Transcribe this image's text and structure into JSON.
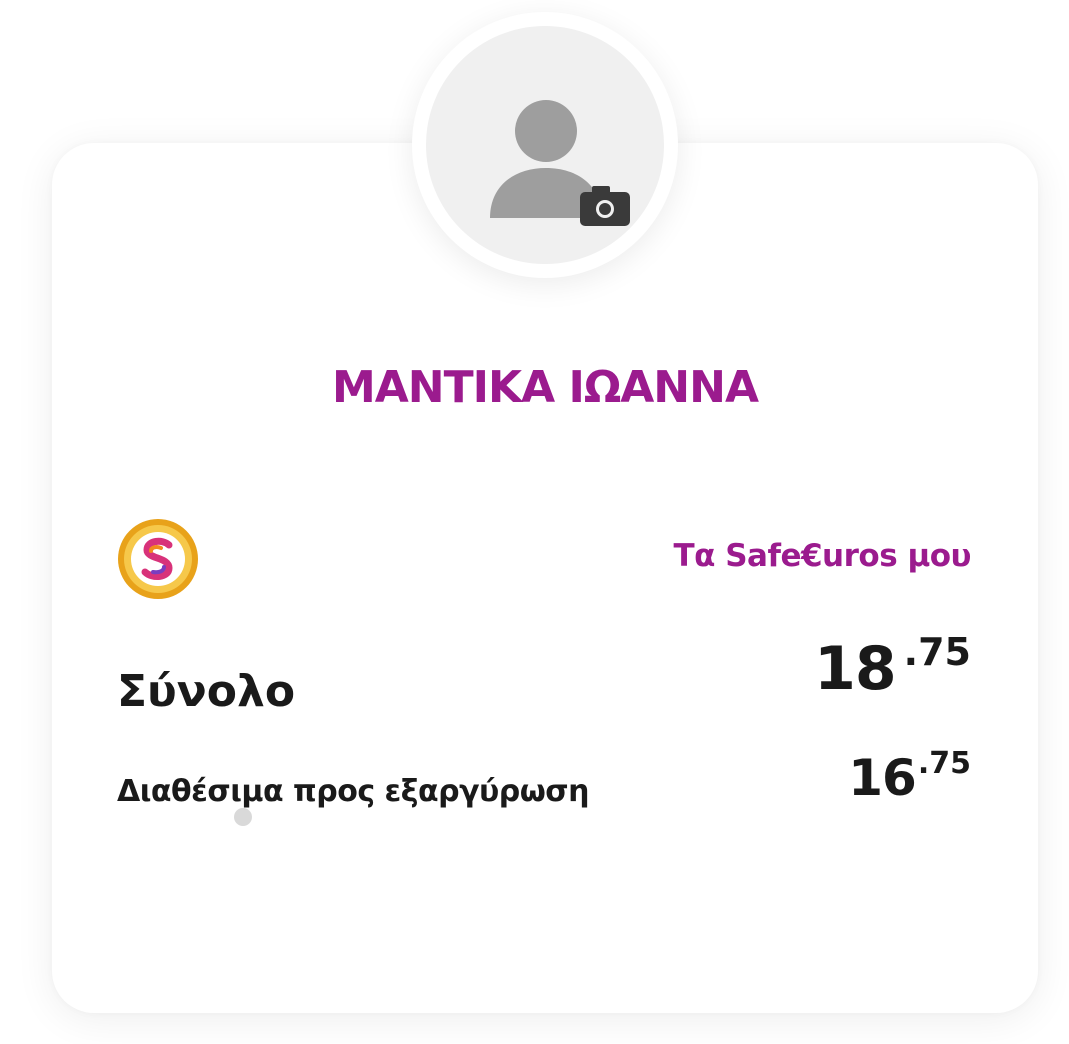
{
  "profile": {
    "name": "ΜΑΝΤΙΚΑ ΙΩΑΝΝΑ",
    "avatar_icon": "user-placeholder-icon",
    "camera_icon": "camera-icon"
  },
  "safeeuros": {
    "coin_icon": "safeeuros-coin-icon",
    "link_label": "Τα Safe€uros μου"
  },
  "total": {
    "label": "Σύνολο",
    "int": "18",
    "dec": ".75"
  },
  "available": {
    "label": "Διαθέσιμα προς εξαργύρωση",
    "int": "16",
    "dec": ".75"
  },
  "colors": {
    "accent": "#9b1b8e",
    "text": "#1a1a1a",
    "avatar_bg": "#f0f0f0",
    "avatar_icon": "#9e9e9e"
  }
}
